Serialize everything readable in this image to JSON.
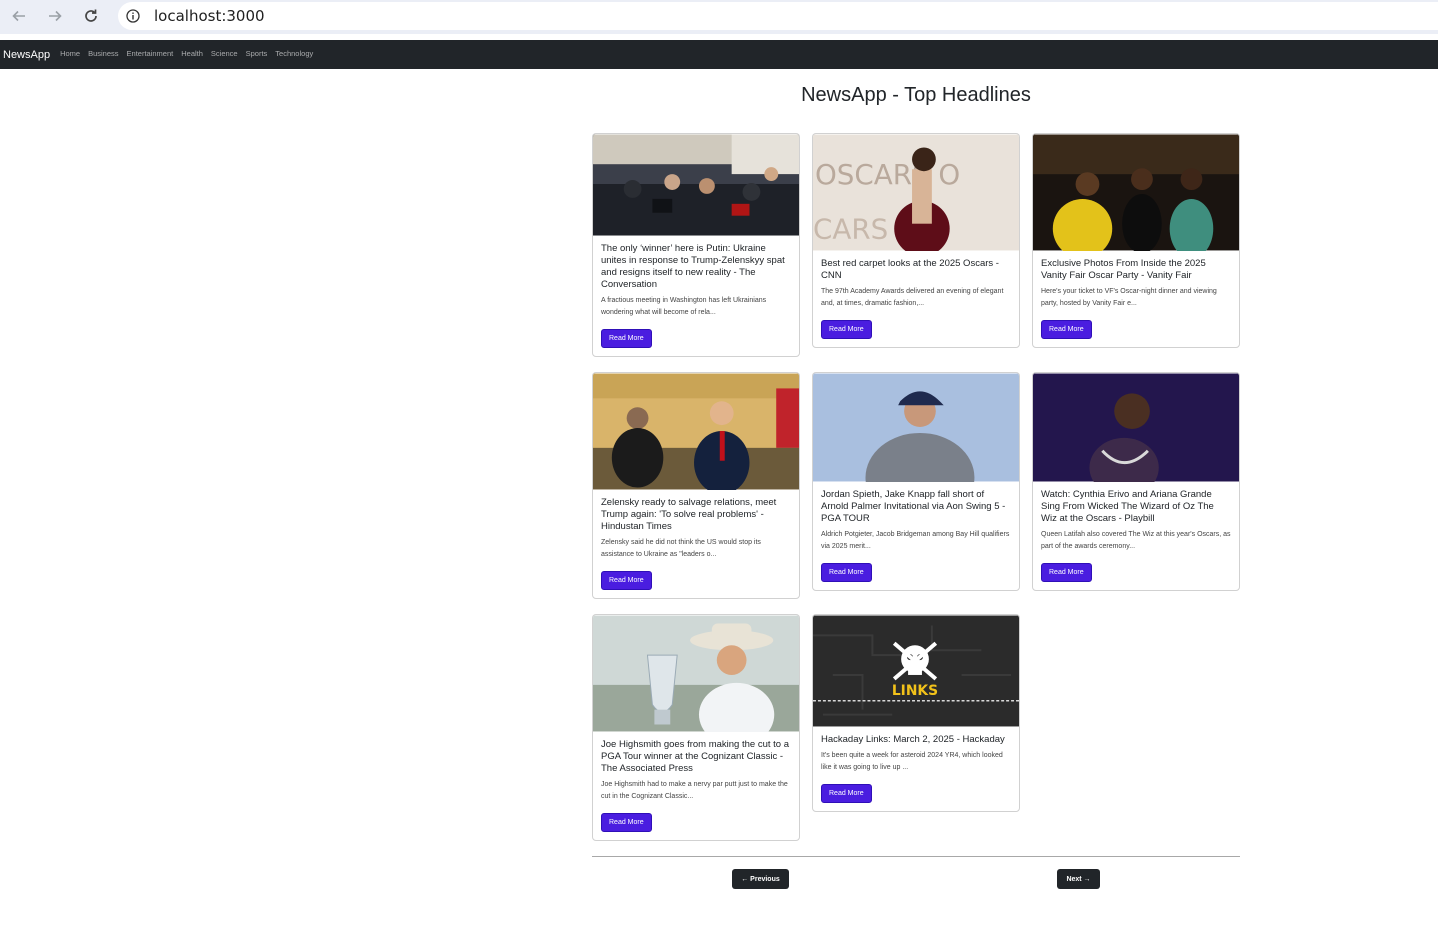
{
  "browser": {
    "url": "localhost:3000"
  },
  "navbar": {
    "brand": "NewsApp",
    "links": [
      "Home",
      "Business",
      "Entertainment",
      "Health",
      "Science",
      "Sports",
      "Technology"
    ]
  },
  "page": {
    "title": "NewsApp - Top Headlines"
  },
  "articles": [
    {
      "title": "The only ‘winner’ here is Putin: Ukraine unites in response to Trump-Zelenskyy spat and resigns itself to new reality - The Conversation",
      "description": "A fractious meeting in Washington has left Ukrainians wondering what will become of rela...",
      "button": "Read More"
    },
    {
      "title": "Best red carpet looks at the 2025 Oscars - CNN",
      "description": "The 97th Academy Awards delivered an evening of elegant and, at times, dramatic fashion,...",
      "button": "Read More"
    },
    {
      "title": "Exclusive Photos From Inside the 2025 Vanity Fair Oscar Party - Vanity Fair",
      "description": "Here's your ticket to VF's Oscar-night dinner and viewing party, hosted by Vanity Fair e...",
      "button": "Read More"
    },
    {
      "title": "Zelensky ready to salvage relations, meet Trump again: 'To solve real problems' - Hindustan Times",
      "description": "Zelensky said he did not think the US would stop its assistance to Ukraine as \"leaders o...",
      "button": "Read More"
    },
    {
      "title": "Jordan Spieth, Jake Knapp fall short of Arnold Palmer Invitational via Aon Swing 5 - PGA TOUR",
      "description": "Aldrich Potgieter, Jacob Bridgeman among Bay Hill qualifiers via 2025 merit...",
      "button": "Read More"
    },
    {
      "title": "Watch: Cynthia Erivo and Ariana Grande Sing From Wicked The Wizard of Oz The Wiz at the Oscars - Playbill",
      "description": "Queen Latifah also covered The Wiz at this year's Oscars, as part of the awards ceremony...",
      "button": "Read More"
    },
    {
      "title": "Joe Highsmith goes from making the cut to a PGA Tour winner at the Cognizant Classic - The Associated Press",
      "description": "Joe Highsmith had to make a nervy par putt just to make the cut in the Cognizant Classic...",
      "button": "Read More"
    },
    {
      "title": "Hackaday Links: March 2, 2025 - Hackaday",
      "description": "It's been quite a week for asteroid 2024 YR4, which looked like it was going to live up ...",
      "button": "Read More",
      "image_text": "LINKS"
    }
  ],
  "pagination": {
    "previous": "← Previous",
    "next": "Next →"
  },
  "colors": {
    "navbar_bg": "#212529",
    "button_primary": "#4a1de0",
    "pagination_bg": "#212529"
  }
}
